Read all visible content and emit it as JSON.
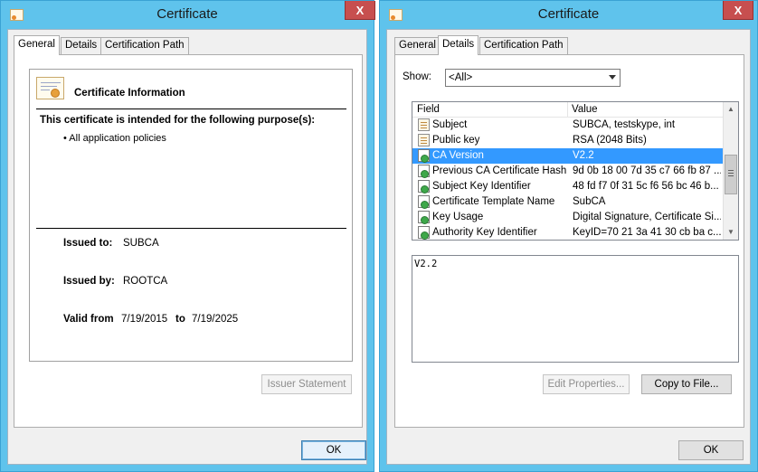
{
  "left_window": {
    "title": "Certificate",
    "close_label": "X",
    "tabs": [
      {
        "label": "General",
        "active": true
      },
      {
        "label": "Details",
        "active": false
      },
      {
        "label": "Certification Path",
        "active": false
      }
    ],
    "info_heading": "Certificate Information",
    "purpose_heading": "This certificate is intended for the following purpose(s):",
    "purposes": [
      "• All application policies"
    ],
    "issued_to_label": "Issued to:",
    "issued_to_value": "SUBCA",
    "issued_by_label": "Issued by:",
    "issued_by_value": "ROOTCA",
    "valid_from_label": "Valid from",
    "valid_from_value": "7/19/2015",
    "valid_to_label": "to",
    "valid_to_value": "7/19/2025",
    "issuer_statement_button": "Issuer Statement",
    "ok_button": "OK"
  },
  "right_window": {
    "title": "Certificate",
    "close_label": "X",
    "tabs": [
      {
        "label": "General",
        "active": false
      },
      {
        "label": "Details",
        "active": true
      },
      {
        "label": "Certification Path",
        "active": false
      }
    ],
    "show_label": "Show:",
    "show_value": "<All>",
    "columns": {
      "field": "Field",
      "value": "Value"
    },
    "rows": [
      {
        "field": "Subject",
        "value": "SUBCA, testskype, int",
        "icon": "certificate-field-icon"
      },
      {
        "field": "Public key",
        "value": "RSA (2048 Bits)",
        "icon": "certificate-field-icon"
      },
      {
        "field": "CA Version",
        "value": "V2.2",
        "icon": "extension-icon",
        "selected": true
      },
      {
        "field": "Previous CA Certificate Hash",
        "value": "9d 0b 18 00 7d 35 c7 66 fb 87 ...",
        "icon": "extension-icon"
      },
      {
        "field": "Subject Key Identifier",
        "value": "48 fd f7 0f 31 5c f6 56 bc 46 b...",
        "icon": "extension-icon"
      },
      {
        "field": "Certificate Template Name",
        "value": "SubCA",
        "icon": "extension-icon"
      },
      {
        "field": "Key Usage",
        "value": "Digital Signature, Certificate Si...",
        "icon": "critical-extension-icon"
      },
      {
        "field": "Authority Key Identifier",
        "value": "KeyID=70 21 3a 41 30 cb ba c...",
        "icon": "extension-icon"
      }
    ],
    "value_text": "V2.2",
    "edit_properties_button": "Edit Properties...",
    "copy_to_file_button": "Copy to File...",
    "ok_button": "OK"
  }
}
